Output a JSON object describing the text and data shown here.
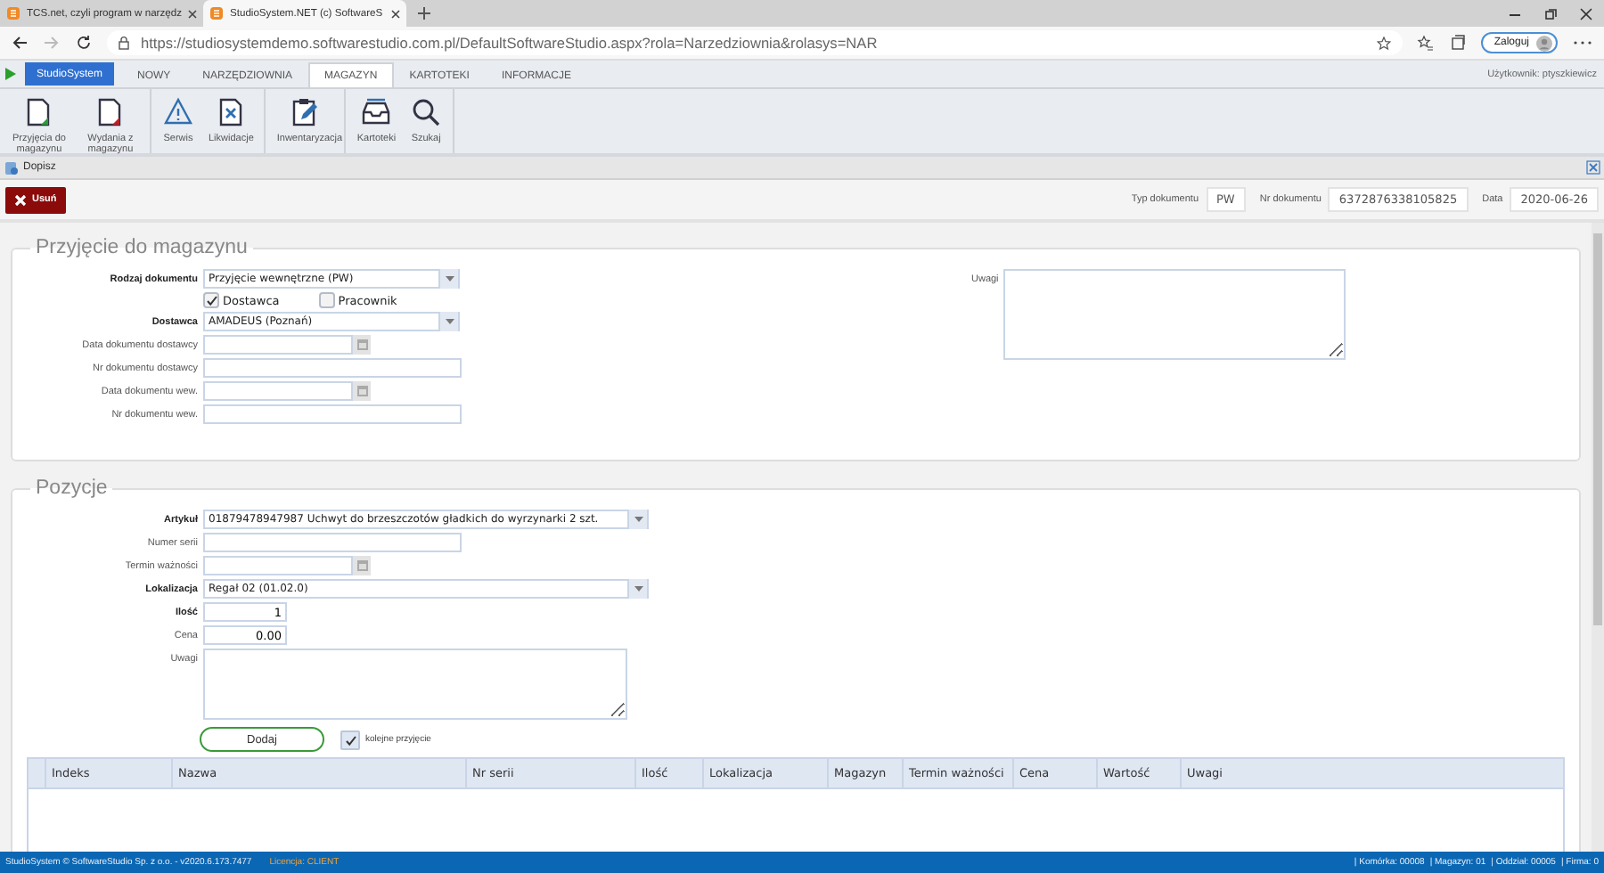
{
  "browser": {
    "tabs": [
      {
        "title": "TCS.net, czyli program w narzędz",
        "selected": false
      },
      {
        "title": "StudioSystem.NET (c) SoftwareS",
        "selected": true
      }
    ],
    "url": "https://studiosystemdemo.softwarestudio.com.pl/DefaultSoftwareStudio.aspx?rola=Narzedziownia&rolasys=NAR",
    "profile_button": "Zaloguj"
  },
  "app": {
    "home_button": "StudioSystem",
    "menu": [
      {
        "label": "NOWY",
        "selected": false
      },
      {
        "label": "NARZĘDZIOWNIA",
        "selected": false
      },
      {
        "label": "MAGAZYN",
        "selected": true
      },
      {
        "label": "KARTOTEKI",
        "selected": false
      },
      {
        "label": "INFORMACJE",
        "selected": false
      }
    ],
    "user": "Użytkownik: ptyszkiewicz",
    "ribbon": [
      {
        "items": [
          {
            "label": "Przyjęcia do magazynu",
            "kind": "receipt"
          },
          {
            "label": "Wydania z magazynu",
            "kind": "issue"
          }
        ]
      },
      {
        "items": [
          {
            "label": "Serwis",
            "kind": "service"
          },
          {
            "label": "Likwidacje",
            "kind": "disposal"
          }
        ]
      },
      {
        "items": [
          {
            "label": "Inwentaryzacja",
            "kind": "inventory"
          }
        ]
      },
      {
        "items": [
          {
            "label": "Kartoteki",
            "kind": "files"
          },
          {
            "label": "Szukaj",
            "kind": "search"
          }
        ]
      }
    ]
  },
  "panel": {
    "title": "Dopisz"
  },
  "toolbar": {
    "delete_button": "Usuń",
    "fields": [
      {
        "label": "Typ dokumentu",
        "value": "PW"
      },
      {
        "label": "Nr dokumentu",
        "value": "6372876338105825"
      },
      {
        "label": "Data",
        "value": "2020-06-26"
      }
    ]
  },
  "sections": [
    {
      "title": "Przyjęcie do magazynu",
      "fields": [
        {
          "kind": "select",
          "label": "Rodzaj dokumentu",
          "required": true,
          "value": "Przyjęcie wewnętrzne (PW)"
        },
        {
          "kind": "checks",
          "options": [
            {
              "label": "Dostawca",
              "checked": true
            },
            {
              "label": "Pracownik",
              "checked": false
            }
          ]
        },
        {
          "kind": "select",
          "label": "Dostawca",
          "required": true,
          "value": "AMADEUS (Poznań)"
        },
        {
          "kind": "date",
          "label": "Data dokumentu dostawcy",
          "required": false
        },
        {
          "kind": "text",
          "label": "Nr dokumentu dostawcy",
          "required": false
        },
        {
          "kind": "date",
          "label": "Data dokumentu wew.",
          "required": false
        },
        {
          "kind": "text",
          "label": "Nr dokumentu wew.",
          "required": false
        }
      ],
      "notes": {
        "label": "Uwagi"
      }
    },
    {
      "title": "Pozycje",
      "fields": [
        {
          "kind": "select",
          "label": "Artykuł",
          "required": true,
          "value": "01879478947987 Uchwyt do brzeszczotów gładkich do wyrzynarki 2 szt."
        },
        {
          "kind": "text",
          "label": "Numer serii",
          "required": false
        },
        {
          "kind": "date",
          "label": "Termin ważności",
          "required": false
        },
        {
          "kind": "select",
          "label": "Lokalizacja",
          "required": true,
          "value": "Regał 02 (01.02.0)"
        },
        {
          "kind": "number",
          "label": "Ilość",
          "required": true,
          "value": "1"
        },
        {
          "kind": "number",
          "label": "Cena",
          "required": false,
          "value": "0.00"
        },
        {
          "kind": "textarea",
          "label": "Uwagi",
          "required": false
        }
      ],
      "add_button": "Dodaj",
      "next_entry": {
        "label": "kolejne przyjęcie",
        "checked": true
      },
      "table": {
        "columns": [
          "Indeks",
          "Nazwa",
          "Nr serii",
          "Ilość",
          "Lokalizacja",
          "Magazyn",
          "Termin ważności",
          "Cena",
          "Wartość",
          "Uwagi"
        ]
      }
    }
  ],
  "status_bar": {
    "copyright": "StudioSystem © SoftwareStudio Sp. z o.o. - v2020.6.173.7477",
    "license": "Licencja: CLIENT",
    "items": [
      "| Komórka: 00008",
      "| Magazyn: 01",
      "| Oddział: 00005",
      "| Firma: 0"
    ]
  }
}
